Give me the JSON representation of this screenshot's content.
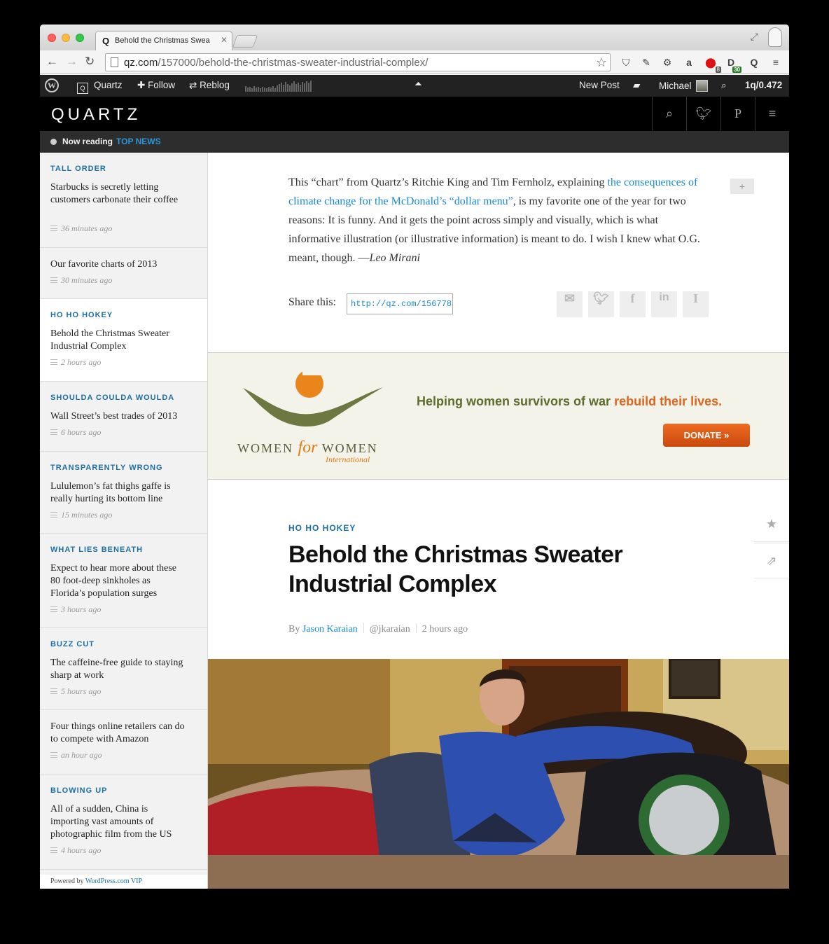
{
  "browser": {
    "tab_title": "Behold the Christmas Swea",
    "tab_favicon": "Q",
    "url_host": "qz.com",
    "url_path": "/157000/behold-the-christmas-sweater-industrial-complex/",
    "ext_badges": [
      "8",
      "30"
    ]
  },
  "wpbar": {
    "site": "Quartz",
    "follow": "Follow",
    "reblog": "Reblog",
    "new_post": "New Post",
    "user": "Michael",
    "stats": "1q/0.472"
  },
  "header": {
    "logo": "QUARTZ",
    "now_reading": "Now reading",
    "section": "TOP NEWS"
  },
  "sidebar": {
    "items": [
      {
        "kicker": "TALL ORDER",
        "title": "Starbucks is secretly letting customers carbonate their coffee",
        "time": "36 minutes ago"
      },
      {
        "kicker": "",
        "title": "Our favorite charts of 2013",
        "time": "30 minutes ago"
      },
      {
        "kicker": "HO HO HOKEY",
        "title": "Behold the Christmas Sweater Industrial Complex",
        "time": "2 hours ago"
      },
      {
        "kicker": "SHOULDA COULDA WOULDA",
        "title": "Wall Street’s best trades of 2013",
        "time": "6 hours ago"
      },
      {
        "kicker": "TRANSPARENTLY WRONG",
        "title": "Lululemon’s fat thighs gaffe is really hurting its bottom line",
        "time": "15 minutes ago"
      },
      {
        "kicker": "WHAT LIES BENEATH",
        "title": "Expect to hear more about these 80 foot-deep sinkholes as Florida’s population surges",
        "time": "3 hours ago"
      },
      {
        "kicker": "BUZZ CUT",
        "title": "The caffeine-free guide to staying sharp at work",
        "time": "5 hours ago"
      },
      {
        "kicker": "",
        "title": "Four things online retailers can do to compete with Amazon",
        "time": "an hour ago"
      },
      {
        "kicker": "BLOWING UP",
        "title": "All of a sudden, China is importing vast amounts of photographic film from the US",
        "time": "4 hours ago"
      }
    ],
    "footer_prefix": "Powered by",
    "footer_link": "WordPress.com VIP"
  },
  "main": {
    "quote": {
      "before": "This “chart” from Quartz’s Ritchie King and Tim Fernholz, explaining ",
      "link": "the consequences of climate change for the McDonald’s “dollar menu”",
      "after": ", is my favorite one of the year for two reasons: It is funny. And it gets the point across simply and visually, which is what informative illustration (or illustrative information) is meant to do. I wish I knew what O.G. meant, though. —",
      "author": "Leo Mirani"
    },
    "share_label": "Share this:",
    "share_url": "http://qz.com/156778",
    "ad": {
      "logo_women1": "WOMEN ",
      "logo_for": "for",
      "logo_women2": " WOMEN",
      "logo_intl": "International",
      "headline_a": "Helping women survivors of war ",
      "headline_b": "rebuild their lives.",
      "donate": "DONATE »"
    },
    "article": {
      "kicker": "HO HO HOKEY",
      "title": "Behold the Christmas Sweater Industrial Complex",
      "by": "By",
      "author": "Jason Karaian",
      "handle": "@jkaraian",
      "time": "2 hours ago"
    }
  },
  "colors": {
    "link_blue": "#1a8bd0",
    "kicker_blue": "#1c6ea6",
    "ad_green": "#5d6b2d",
    "ad_orange": "#e0641c"
  }
}
